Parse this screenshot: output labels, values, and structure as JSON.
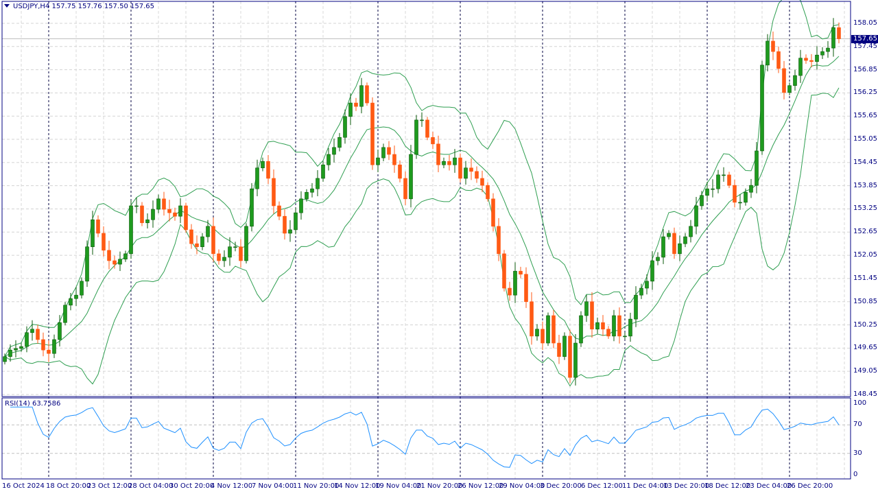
{
  "header": {
    "symbol": "USDJPY,H4",
    "ohlc": "157.75 157.76 157.50 157.65"
  },
  "rsi": {
    "title": "RSI(14) 63.7586",
    "levels": [
      "100",
      "70",
      "30",
      "0"
    ]
  },
  "price_axis": [
    "158.05",
    "157.45",
    "156.85",
    "156.25",
    "155.65",
    "155.05",
    "154.45",
    "153.85",
    "153.25",
    "152.65",
    "152.05",
    "151.45",
    "150.85",
    "150.25",
    "149.65",
    "149.05",
    "148.45"
  ],
  "current_price": "157.65",
  "time_axis": [
    "16 Oct 2024",
    "18 Oct 20:00",
    "23 Oct 12:00",
    "28 Oct 04:00",
    "30 Oct 20:00",
    "4 Nov 12:00",
    "7 Nov 04:00",
    "11 Nov 20:00",
    "14 Nov 12:00",
    "19 Nov 04:00",
    "21 Nov 20:00",
    "26 Nov 12:00",
    "29 Nov 04:00",
    "3 Dec 20:00",
    "6 Dec 12:00",
    "11 Dec 04:00",
    "13 Dec 20:00",
    "18 Dec 12:00",
    "23 Dec 04:00",
    "26 Dec 20:00"
  ],
  "colors": {
    "bull": "#1e9a1e",
    "bear": "#ff5a14",
    "bands": "#2e9e50",
    "rsi": "#1e90ff",
    "axis": "#000080"
  },
  "chart_data": {
    "type": "candlestick",
    "title": "USDJPY,H4",
    "ylim": [
      148.45,
      158.35
    ],
    "first_open": 149.3,
    "closes": [
      149.43,
      149.6,
      149.64,
      149.69,
      150.05,
      150.14,
      149.87,
      149.6,
      149.51,
      149.87,
      150.31,
      150.76,
      150.93,
      151.02,
      151.38,
      152.27,
      152.97,
      152.62,
      152.18,
      151.91,
      151.82,
      151.95,
      152.09,
      153.33,
      153.33,
      152.89,
      152.97,
      153.24,
      153.51,
      153.24,
      153.15,
      153.06,
      153.33,
      152.71,
      152.35,
      152.27,
      152.53,
      152.8,
      152.09,
      151.91,
      152.0,
      152.27,
      152.27,
      151.91,
      152.8,
      153.77,
      154.31,
      154.48,
      154.04,
      153.33,
      153.06,
      152.62,
      152.71,
      153.15,
      153.51,
      153.68,
      153.77,
      154.04,
      154.39,
      154.66,
      154.84,
      155.1,
      155.64,
      155.99,
      155.9,
      156.44,
      155.99,
      154.39,
      154.57,
      154.84,
      154.66,
      154.39,
      154.04,
      153.51,
      154.66,
      155.55,
      155.55,
      155.1,
      154.93,
      154.39,
      154.48,
      154.39,
      154.57,
      154.04,
      154.31,
      154.22,
      154.04,
      153.86,
      153.51,
      152.8,
      152.09,
      151.2,
      151.02,
      151.64,
      151.56,
      150.85,
      149.96,
      150.14,
      149.78,
      150.49,
      149.78,
      149.43,
      149.96,
      148.89,
      149.78,
      150.49,
      150.85,
      150.14,
      150.31,
      150.14,
      149.96,
      150.49,
      149.96,
      149.96,
      150.4,
      151.02,
      151.2,
      151.38,
      151.91,
      152.0,
      152.53,
      152.62,
      152.09,
      152.35,
      152.53,
      152.8,
      153.33,
      153.6,
      153.77,
      153.77,
      154.13,
      154.13,
      153.86,
      153.42,
      153.42,
      153.68,
      153.86,
      154.75,
      156.97,
      157.59,
      157.32,
      156.88,
      156.26,
      156.44,
      156.7,
      157.15,
      157.09,
      157.06,
      157.23,
      157.32,
      157.41,
      157.94,
      157.65
    ]
  }
}
